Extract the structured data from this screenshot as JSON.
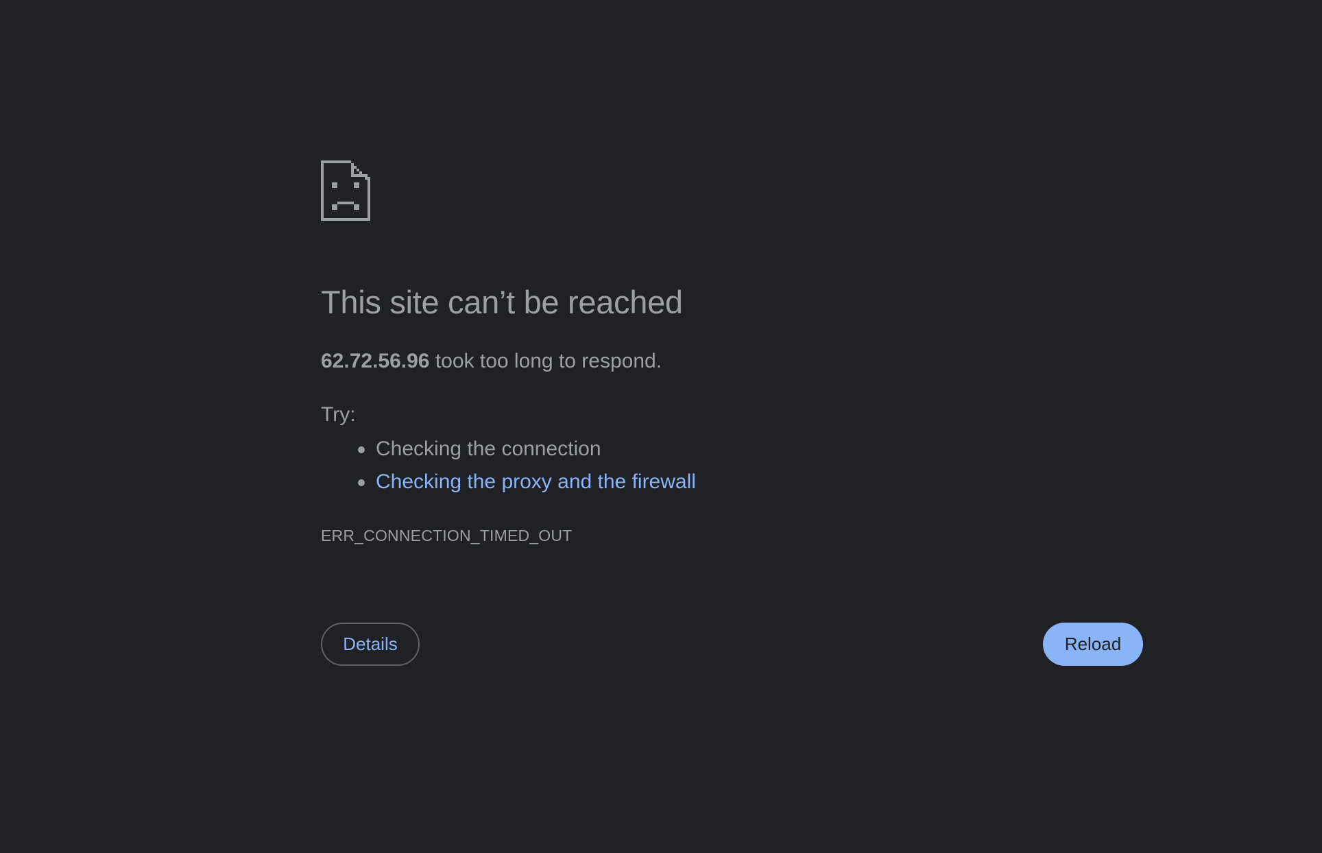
{
  "error_page": {
    "icon": "sad-document-icon",
    "title": "This site can’t be reached",
    "summary": {
      "host": "62.72.56.96",
      "message": " took too long to respond."
    },
    "try_label": "Try:",
    "suggestions": [
      {
        "text": "Checking the connection",
        "is_link": false
      },
      {
        "text": "Checking the proxy and the firewall",
        "is_link": true
      }
    ],
    "error_code": "ERR_CONNECTION_TIMED_OUT",
    "details_label": "Details",
    "reload_label": "Reload"
  },
  "colors": {
    "background": "#202124",
    "text": "#9aa0a6",
    "link": "#8ab4f8",
    "primary_button": "#8ab4f8",
    "border": "#5f6368"
  }
}
